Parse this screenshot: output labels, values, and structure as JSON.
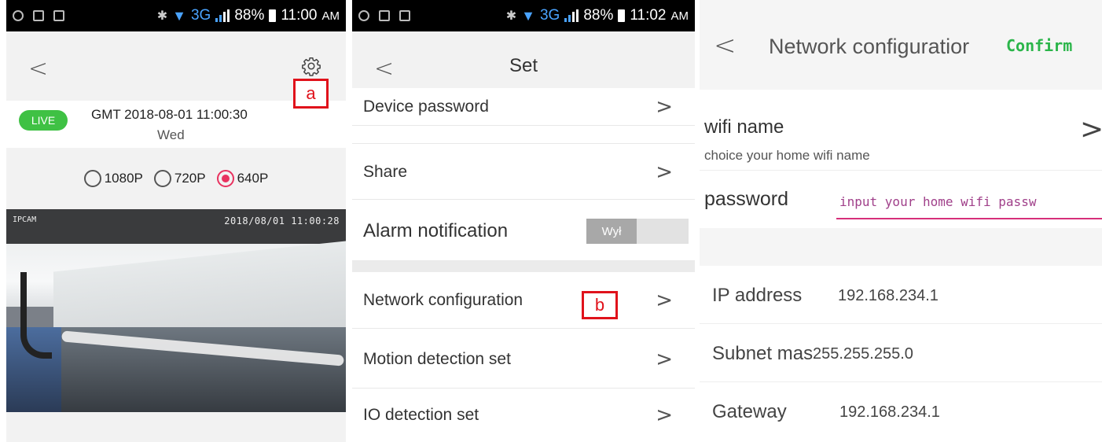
{
  "panel1": {
    "status": {
      "battery": "88%",
      "time": "11:00",
      "ampm": "AM",
      "network": "3G"
    },
    "back_glyph": "<",
    "annotation_a": "a",
    "live_badge": "LIVE",
    "gmt": "GMT 2018-08-01 11:00:30",
    "weekday": "Wed",
    "resolutions": [
      {
        "label": "1080P",
        "selected": false
      },
      {
        "label": "720P",
        "selected": false
      },
      {
        "label": "640P",
        "selected": true
      }
    ],
    "video": {
      "osd_left": "IPCAM",
      "osd_right": "2018/08/01 11:00:28"
    }
  },
  "panel2": {
    "status": {
      "battery": "88%",
      "time": "11:02",
      "ampm": "AM",
      "network": "3G"
    },
    "back_glyph": "<",
    "title": "Set",
    "rows": {
      "device_password": "Device password",
      "share": "Share",
      "alarm_notification": "Alarm notification",
      "alarm_toggle": "Wył",
      "network_configuration": "Network configuration",
      "motion_detection": "Motion detection set",
      "io_detection": "IO detection set"
    },
    "chevron": ">",
    "annotation_b": "b"
  },
  "panel3": {
    "back_glyph": "<",
    "title": "Network configuratior",
    "confirm": "Confirm",
    "wifi_name": "wifi name",
    "wifi_sub": "choice your home wifi name",
    "chevron": ">",
    "password_label": "password",
    "password_placeholder": "input your home wifi passw",
    "ip_label": "IP address",
    "ip_value": "192.168.234.1",
    "subnet_label": "Subnet mas",
    "subnet_value": "255.255.255.0",
    "gateway_label": "Gateway",
    "gateway_value": "192.168.234.1"
  }
}
